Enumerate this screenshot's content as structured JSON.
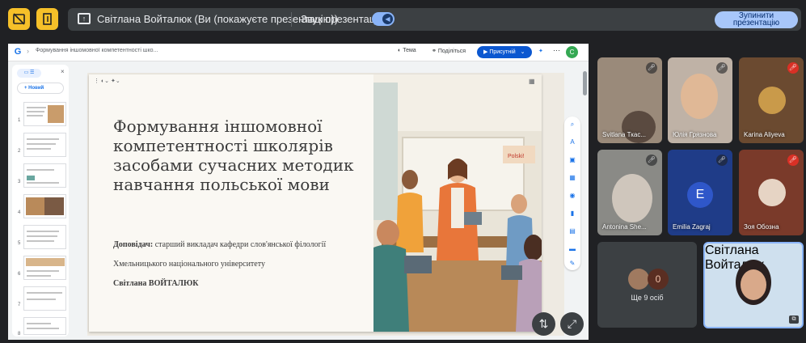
{
  "topbar": {
    "presenter_text": "Світлана Войталюк (Ви (покажуєте презентацію))",
    "sound_label": "Звук презентації",
    "stop_button": "Зупинити презентацію"
  },
  "doc": {
    "title": "Формування іншомовної компетентності шко...",
    "theme_label": "Тема",
    "share_label": "Поділіться",
    "present_label": "Присутній",
    "avatar_letter": "С",
    "new_label": "+ Новий"
  },
  "thumbnails": [
    "1",
    "2",
    "3",
    "4",
    "5",
    "6",
    "7",
    "8"
  ],
  "slide": {
    "title": "Формування іншомовної компетентності школярів засобами сучасних методик навчання польської мови",
    "speaker_label": "Доповідач:",
    "speaker_role": "старший викладач кафедри слов'янської філології",
    "university": "Хмельницького національного університету",
    "author": "Світлана ВОЙТАЛЮК",
    "board_word": "Polski!"
  },
  "participants": [
    {
      "name": "Svitlana Ткас...",
      "mic": "off"
    },
    {
      "name": "Юлія Грязнова",
      "mic": "off"
    },
    {
      "name": "Karina Aliyeva",
      "mic": "off-red"
    },
    {
      "name": "Antonina She...",
      "mic": "off"
    },
    {
      "name": "Emilia Zagraj",
      "mic": "off",
      "initial": "E"
    },
    {
      "name": "Зоя Обозна",
      "mic": "off-red"
    }
  ],
  "more": {
    "count": "0",
    "label": "Ще 9 осіб"
  },
  "self": {
    "name": "Світлана Войталюк"
  },
  "colors": {
    "accent": "#0b57d0",
    "stop_bg": "#a8c7fa",
    "yellow": "#f6c029",
    "background": "#202124"
  }
}
